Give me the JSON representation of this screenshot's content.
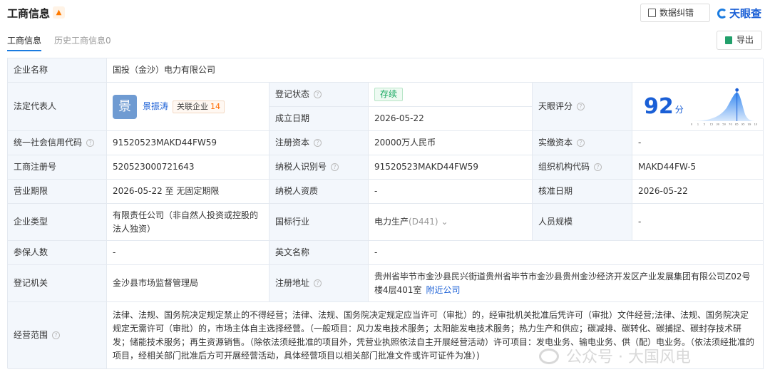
{
  "header": {
    "title": "工商信息",
    "correct_label": "数据纠错",
    "logo_text": "天眼查"
  },
  "tabs": [
    {
      "label": "工商信息"
    },
    {
      "label": "历史工商信息",
      "count": "0"
    }
  ],
  "export_label": "导出",
  "rows": {
    "company_name": {
      "label": "企业名称",
      "value": "国投（金沙）电力有限公司"
    },
    "legal_rep": {
      "label": "法定代表人",
      "avatar_char": "景",
      "name": "景振涛",
      "related_label": "关联企业",
      "related_count": "14"
    },
    "reg_status": {
      "label": "登记状态",
      "value": "存续"
    },
    "found_date": {
      "label": "成立日期",
      "value": "2026-05-22"
    },
    "tianyan_score": {
      "label": "天眼评分",
      "value": "92",
      "unit": "分",
      "axis_ticks": [
        "0",
        "1",
        "5",
        "15",
        "30",
        "50",
        "70",
        "85",
        "95",
        "99",
        "100"
      ]
    },
    "credit_code": {
      "label": "统一社会信用代码",
      "value": "91520523MAKD44FW59"
    },
    "reg_capital": {
      "label": "注册资本",
      "value": "20000万人民币"
    },
    "paid_capital": {
      "label": "实缴资本",
      "value": "-"
    },
    "reg_number": {
      "label": "工商注册号",
      "value": "520523000721643"
    },
    "taxpayer_id": {
      "label": "纳税人识别号",
      "value": "91520523MAKD44FW59"
    },
    "org_code": {
      "label": "组织机构代码",
      "value": "MAKD44FW-5"
    },
    "business_term": {
      "label": "营业期限",
      "value": "2026-05-22 至 无固定期限"
    },
    "taxpayer_qual": {
      "label": "纳税人资质",
      "value": "-"
    },
    "approval_date": {
      "label": "核准日期",
      "value": "2026-05-22"
    },
    "company_type": {
      "label": "企业类型",
      "value": "有限责任公司（非自然人投资或控股的法人独资）"
    },
    "industry": {
      "label": "国标行业",
      "value": "电力生产",
      "code": "(D441)"
    },
    "staff_size": {
      "label": "人员规模",
      "value": "-"
    },
    "insured": {
      "label": "参保人数",
      "value": "-"
    },
    "english_name": {
      "label": "英文名称",
      "value": "-"
    },
    "reg_authority": {
      "label": "登记机关",
      "value": "金沙县市场监督管理局"
    },
    "reg_address": {
      "label": "注册地址",
      "value": "贵州省毕节市金沙县民兴街道贵州省毕节市金沙县贵州金沙经济开发区产业发展集团有限公司Z02号楼4层401室",
      "link": "附近公司"
    },
    "scope": {
      "label": "经营范围",
      "value": "法律、法规、国务院决定规定禁止的不得经营；法律、法规、国务院决定规定应当许可（审批）的，经审批机关批准后凭许可（审批）文件经营;法律、法规、国务院决定规定无需许可（审批）的，市场主体自主选择经营。（一般项目：风力发电技术服务；太阳能发电技术服务；热力生产和供应；碳减排、碳转化、碳捕捉、碳封存技术研发；储能技术服务；再生资源销售。（除依法须经批准的项目外，凭营业执照依法自主开展经营活动）许可项目：发电业务、输电业务、供（配）电业务。（依法须经批准的项目，经相关部门批准后方可开展经营活动，具体经营项目以相关部门批准文件或许可证件为准）)"
    }
  },
  "watermark": "公众号 · 大国风电",
  "colors": {
    "accent": "#1a5fd6",
    "status_green": "#13a75e",
    "label_bg": "#f3f7fc",
    "border": "#e4e9f0"
  }
}
